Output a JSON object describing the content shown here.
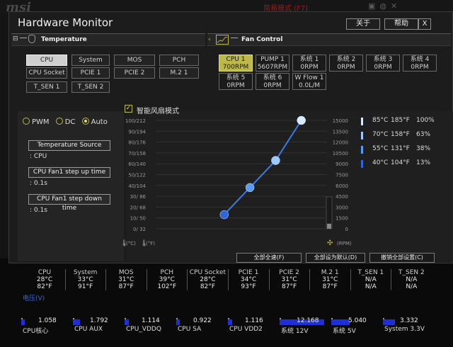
{
  "background": {
    "logo": "msi",
    "mode_text": "简易模式 (F7)"
  },
  "window": {
    "title": "Hardware Monitor",
    "about_label": "关于",
    "help_label": "帮助",
    "close_label": "X"
  },
  "temperature_panel": {
    "tab_label": "Temperature",
    "sensors": [
      "CPU",
      "System",
      "MOS",
      "PCH",
      "CPU Socket",
      "PCIE 1",
      "PCIE 2",
      "M.2 1",
      "T_SEN 1",
      "T_SEN 2"
    ],
    "selected": "CPU"
  },
  "fan_panel": {
    "tab_label": "Fan Control",
    "fans": [
      {
        "name": "CPU 1",
        "rpm": "700RPM"
      },
      {
        "name": "PUMP 1",
        "rpm": "5607RPM"
      },
      {
        "name": "系统 1",
        "rpm": "0RPM"
      },
      {
        "name": "系统 2",
        "rpm": "0RPM"
      },
      {
        "name": "系统 3",
        "rpm": "0RPM"
      },
      {
        "name": "系统 4",
        "rpm": "0RPM"
      },
      {
        "name": "系统 5",
        "rpm": "0RPM"
      },
      {
        "name": "系统 6",
        "rpm": "0RPM"
      },
      {
        "name": "W Flow 1",
        "rpm": "0.0L/M"
      }
    ],
    "selected": "CPU 1"
  },
  "mode": {
    "options": [
      "PWM",
      "DC",
      "Auto"
    ],
    "selected": "Auto"
  },
  "settings": {
    "temp_source_label": "Temperature Source",
    "temp_source_value": ": CPU",
    "step_up_label": "CPU Fan1 step up time",
    "step_up_value": ": 0.1s",
    "step_down_label": "CPU Fan1 step down time",
    "step_down_value": ": 0.1s"
  },
  "smart_fan": {
    "label": "智能风扇模式",
    "checked": true
  },
  "chart_data": {
    "type": "line",
    "x_label_c": "(°C)",
    "x_label_f": "(°F)",
    "y_label": "(RPM)",
    "left_ticks": [
      "100/212",
      "90/194",
      "80/176",
      "70/158",
      "60/140",
      "50/122",
      "40/104",
      "30/ 86",
      "20/ 68",
      "10/ 50",
      "0/ 32"
    ],
    "right_ticks": [
      "15000",
      "13500",
      "12000",
      "10500",
      "9000",
      "7500",
      "6000",
      "4500",
      "3000",
      "1500",
      "0"
    ],
    "points": [
      {
        "temp_c": 40,
        "percent": 13
      },
      {
        "temp_c": 55,
        "percent": 38
      },
      {
        "temp_c": 70,
        "percent": 63
      },
      {
        "temp_c": 85,
        "percent": 100
      }
    ],
    "current_rpm": 700,
    "temp_range_c": [
      0,
      100
    ],
    "percent_range": [
      0,
      100
    ]
  },
  "legend": [
    {
      "c": "85°C",
      "f": "185°F",
      "pct": "100%",
      "color": "#d8ecff"
    },
    {
      "c": "70°C",
      "f": "158°F",
      "pct": "63%",
      "color": "#9cc9ff"
    },
    {
      "c": "55°C",
      "f": "131°F",
      "pct": "38%",
      "color": "#5b9bf0"
    },
    {
      "c": "40°C",
      "f": "104°F",
      "pct": "13%",
      "color": "#2f66d8"
    }
  ],
  "actions": {
    "full_speed": "全部全速(F)",
    "set_default": "全部设为默认(D)",
    "cancel_all": "撤销全部设置(C)"
  },
  "monitor": {
    "temps": [
      {
        "label": "CPU",
        "c": "28°C",
        "f": "82°F"
      },
      {
        "label": "System",
        "c": "33°C",
        "f": "91°F"
      },
      {
        "label": "MOS",
        "c": "31°C",
        "f": "87°F"
      },
      {
        "label": "PCH",
        "c": "39°C",
        "f": "102°F"
      },
      {
        "label": "CPU Socket",
        "c": "28°C",
        "f": "82°F"
      },
      {
        "label": "PCIE 1",
        "c": "34°C",
        "f": "93°F"
      },
      {
        "label": "PCIE 2",
        "c": "31°C",
        "f": "87°F"
      },
      {
        "label": "M.2 1",
        "c": "31°C",
        "f": "87°F"
      },
      {
        "label": "T_SEN 1",
        "c": "N/A",
        "f": "N/A"
      },
      {
        "label": "T_SEN 2",
        "c": "N/A",
        "f": "N/A"
      }
    ],
    "voltage_title": "电压(V)",
    "voltages": [
      {
        "label": "CPU核心",
        "value": "1.058",
        "fill": 0.08
      },
      {
        "label": "CPU AUX",
        "value": "1.792",
        "fill": 0.14
      },
      {
        "label": "CPU_VDDQ",
        "value": "1.114",
        "fill": 0.09
      },
      {
        "label": "CPU SA",
        "value": "0.922",
        "fill": 0.07
      },
      {
        "label": "CPU VDD2",
        "value": "1.116",
        "fill": 0.09
      },
      {
        "label": "系统 12V",
        "value": "12.168",
        "fill": 0.92
      },
      {
        "label": "系统 5V",
        "value": "5.040",
        "fill": 0.38
      },
      {
        "label": "System 3.3V",
        "value": "3.332",
        "fill": 0.25
      }
    ]
  }
}
